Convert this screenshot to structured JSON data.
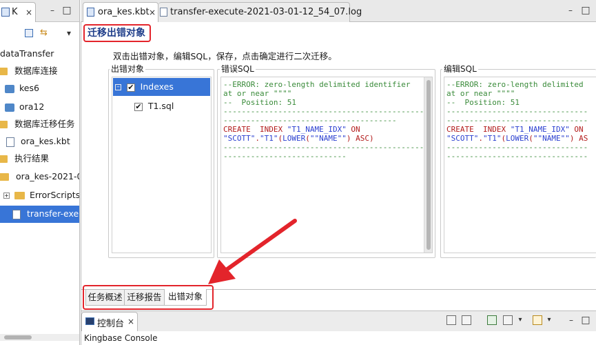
{
  "left_panel": {
    "tab_label": "K",
    "close_glyph": "×",
    "min_glyph": "–",
    "max_glyph": "□",
    "toolbar": {
      "collapse_icon": "collapse-all-icon",
      "link_icon": "link-with-editor-icon",
      "menu_glyph": "▾"
    },
    "tree": {
      "root": "dataTransfer",
      "db_connections": "数据库连接",
      "kes6": "kes6",
      "ora12": "ora12",
      "migration_tasks": "数据库迁移任务",
      "ora_kes_kbt": "ora_kes.kbt",
      "results": "执行结果",
      "result_run": "ora_kes-2021-0",
      "error_scripts": "ErrorScripts",
      "transfer_exec": "transfer-exec"
    }
  },
  "editor": {
    "tabs": [
      {
        "label": "ora_kes.kbt",
        "close": "×"
      },
      {
        "label": "transfer-execute-2021-03-01-12_54_07.log"
      }
    ],
    "min_glyph": "–",
    "max_glyph": "□",
    "section_title": "迁移出错对象",
    "instruction": "双击出错对象，编辑SQL，保存，点击确定进行二次迁移。",
    "error_objects": {
      "label": "出错对象",
      "tree": [
        {
          "label": "Indexes",
          "expand": "–",
          "check": "✔"
        },
        {
          "label": "T1.sql",
          "check": "✔"
        }
      ]
    },
    "error_sql": {
      "label": "错误SQL",
      "lines": {
        "l1": "--ERROR: zero-length delimited identifier",
        "l2": "at or near \"\"\"\"",
        "l3": "--  Position: 51",
        "l4": "--------------------------------------------",
        "l5": "--------------------------------------",
        "l6a": "CREATE  INDEX ",
        "l6b": "\"T1_NAME_IDX\"",
        "l6c": " ON",
        "l7a": "\"SCOTT\"",
        "l7b": ".",
        "l7c": "\"T1\"",
        "l7d": "(",
        "l7e": "LOWER",
        "l7f": "(",
        "l7g": "\"\"NAME\"\"",
        "l7h": ") ASC)",
        "l8": "--------------------------------------------",
        "l9": "---------------------------"
      }
    },
    "edit_sql": {
      "label": "编辑SQL",
      "lines": {
        "l1": "--ERROR: zero-length delimited",
        "l2": "at or near \"\"\"\"",
        "l3": "--  Position: 51",
        "l4": "-------------------------------",
        "l5": "-------------------------------",
        "l6a": "CREATE  INDEX ",
        "l6b": "\"T1_NAME_IDX\"",
        "l6c": " ON",
        "l7a": "\"SCOTT\"",
        "l7b": ".",
        "l7c": "\"T1\"",
        "l7d": "(",
        "l7e": "LOWER",
        "l7f": "(",
        "l7g": "\"\"NAME\"\"",
        "l7h": ") AS",
        "l8": "-------------------------------",
        "l9": "-------------------------------"
      }
    },
    "page_tabs": [
      "任务概述",
      "迁移报告",
      "出错对象"
    ]
  },
  "console": {
    "tab_label": "控制台",
    "close": "×",
    "body_text": "Kingbase Console",
    "toolbar_icons": [
      "clear-console-icon",
      "scroll-lock-icon",
      "pin-console-icon",
      "display-console-icon",
      "dropdown-arrow-icon",
      "open-console-icon",
      "dropdown-arrow-icon"
    ],
    "min_glyph": "–",
    "max_glyph": "□"
  },
  "colors": {
    "highlight_red": "#e3242b",
    "selection_blue": "#3875d7",
    "title_blue": "#1f3e8a"
  }
}
